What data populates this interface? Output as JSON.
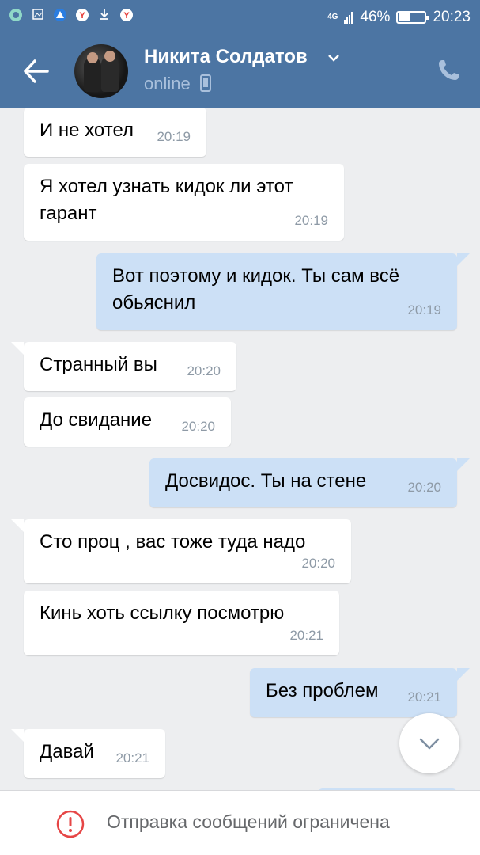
{
  "status_bar": {
    "icons": [
      "chat-bubble-icon",
      "gallery-icon",
      "alert-triangle-icon",
      "yandex-icon",
      "download-icon",
      "yandex-icon"
    ],
    "network": "4G",
    "battery": "46%",
    "battery_level": 0.46,
    "time": "20:23"
  },
  "header": {
    "name": "Никита Солдатов",
    "status": "online"
  },
  "messages": [
    {
      "text": "И не хотел",
      "time": "20:19"
    },
    {
      "text": "Я хотел узнать кидок ли этот гарант",
      "time": "20:19"
    },
    {
      "text": "Вот поэтому и кидок. Ты сам всё обьяснил",
      "time": "20:19"
    },
    {
      "text": "Странный вы",
      "time": "20:20"
    },
    {
      "text": "До свидание",
      "time": "20:20"
    },
    {
      "text": "Досвидос. Ты на стене",
      "time": "20:20"
    },
    {
      "text": "Сто проц , вас тоже туда надо",
      "time": "20:20"
    },
    {
      "text": "Кинь хоть ссылку посмотрю",
      "time": "20:21"
    },
    {
      "text": "Без проблем",
      "time": "20:21"
    },
    {
      "text": "Давай",
      "time": "20:21"
    }
  ],
  "footer": {
    "notice": "Отправка сообщений ограничена"
  },
  "colors": {
    "header": "#4c75a3",
    "outgoing_bubble": "#cce0f6",
    "incoming_bubble": "#ffffff",
    "background": "#edeef0",
    "warning": "#e64646"
  }
}
